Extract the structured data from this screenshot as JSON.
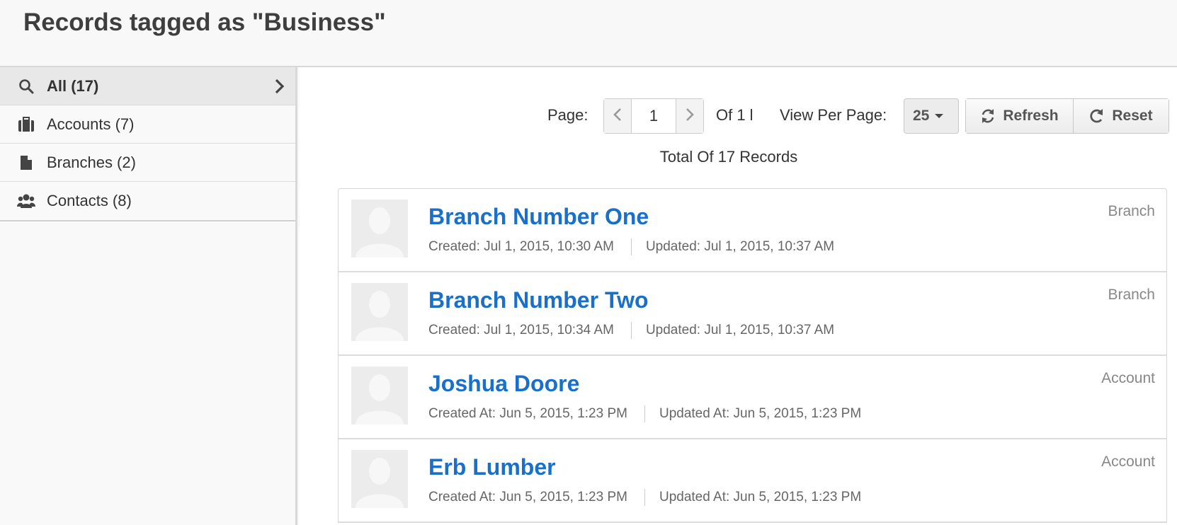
{
  "page": {
    "title": "Records tagged as \"Business\""
  },
  "sidebar": {
    "items": [
      {
        "label": "All (17)",
        "icon": "search-icon",
        "active": true
      },
      {
        "label": "Accounts (7)",
        "icon": "briefcase-icon",
        "active": false
      },
      {
        "label": "Branches (2)",
        "icon": "file-icon",
        "active": false
      },
      {
        "label": "Contacts (8)",
        "icon": "users-icon",
        "active": false
      }
    ]
  },
  "pager": {
    "page_label": "Page:",
    "current_page": "1",
    "of_text": "Of 1 l",
    "view_per_page_label": "View Per Page:",
    "per_page_value": "25",
    "refresh_label": "Refresh",
    "reset_label": "Reset",
    "total_text": "Total Of 17 Records"
  },
  "records": [
    {
      "title": "Branch Number One",
      "created": "Created: Jul 1, 2015, 10:30 AM",
      "updated": "Updated: Jul 1, 2015, 10:37 AM",
      "type": "Branch"
    },
    {
      "title": "Branch Number Two",
      "created": "Created: Jul 1, 2015, 10:34 AM",
      "updated": "Updated: Jul 1, 2015, 10:37 AM",
      "type": "Branch"
    },
    {
      "title": "Joshua Doore",
      "created": "Created At: Jun 5, 2015, 1:23 PM",
      "updated": "Updated At: Jun 5, 2015, 1:23 PM",
      "type": "Account"
    },
    {
      "title": "Erb Lumber",
      "created": "Created At: Jun 5, 2015, 1:23 PM",
      "updated": "Updated At: Jun 5, 2015, 1:23 PM",
      "type": "Account"
    }
  ],
  "colors": {
    "link": "#1a6fc9",
    "active_bg": "#e8e8e8"
  }
}
